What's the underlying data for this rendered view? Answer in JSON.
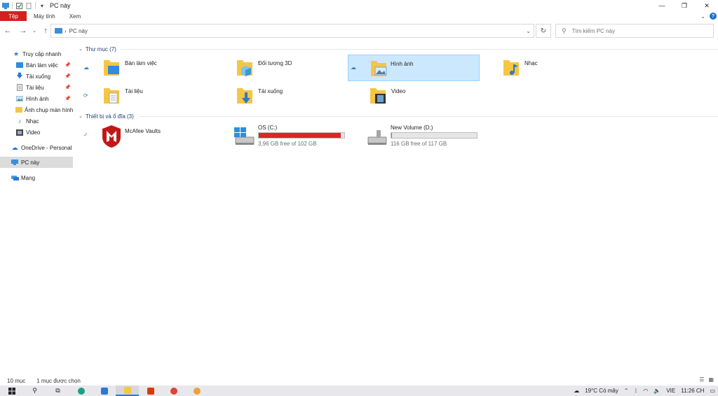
{
  "window": {
    "title": "PC này"
  },
  "ribbon": {
    "tabs": [
      "Tệp",
      "Máy tính",
      "Xem"
    ]
  },
  "address": {
    "crumb": "PC này"
  },
  "search": {
    "placeholder": "Tìm kiếm PC này"
  },
  "navpane": {
    "quick_access": "Truy cập nhanh",
    "items": [
      {
        "label": "Bàn làm việc",
        "icon": "desktop-icon",
        "pinned": true
      },
      {
        "label": "Tải xuống",
        "icon": "download-icon",
        "pinned": true
      },
      {
        "label": "Tài liệu",
        "icon": "document-icon",
        "pinned": true
      },
      {
        "label": "Hình ảnh",
        "icon": "picture-icon",
        "pinned": true
      },
      {
        "label": "Ảnh chụp màn hình",
        "icon": "folder-icon",
        "pinned": false
      },
      {
        "label": "Nhạc",
        "icon": "music-icon",
        "pinned": false
      },
      {
        "label": "Video",
        "icon": "video-icon",
        "pinned": false
      }
    ],
    "onedrive": "OneDrive - Personal",
    "this_pc": "PC này",
    "network": "Mạng"
  },
  "folders": {
    "header": "Thư mục (7)",
    "items": [
      {
        "label": "Bàn làm việc",
        "icon": "desktop-folder-icon"
      },
      {
        "label": "Đối tượng 3D",
        "icon": "3d-objects-folder-icon"
      },
      {
        "label": "Hình ảnh",
        "icon": "pictures-folder-icon",
        "selected": true
      },
      {
        "label": "Nhạc",
        "icon": "music-folder-icon"
      },
      {
        "label": "Tài liệu",
        "icon": "documents-folder-icon"
      },
      {
        "label": "Tải xuống",
        "icon": "downloads-folder-icon"
      },
      {
        "label": "Video",
        "icon": "videos-folder-icon"
      }
    ]
  },
  "devices": {
    "header": "Thiết bị và ổ đĩa (3)",
    "items": [
      {
        "label": "McAfee Vaults",
        "icon": "mcafee-icon"
      },
      {
        "label": "OS (C:)",
        "free": "3,96 GB free of 102 GB",
        "used_fraction": 0.96,
        "bar_color": "#da2626",
        "icon": "windows-drive-icon"
      },
      {
        "label": "New Volume (D:)",
        "free": "116 GB free of 117 GB",
        "used_fraction": 0.01,
        "bar_color": "#26a0da",
        "icon": "drive-icon"
      }
    ]
  },
  "status": {
    "count": "10 mục",
    "selected": "1 mục được chọn"
  },
  "taskbar": {
    "weather": "19°C  Có mây",
    "lang": "VIE",
    "time": "11:26 CH"
  },
  "colors": {
    "accent": "#d42020",
    "selection": "#cce8ff",
    "header_text": "#1e3e78"
  }
}
